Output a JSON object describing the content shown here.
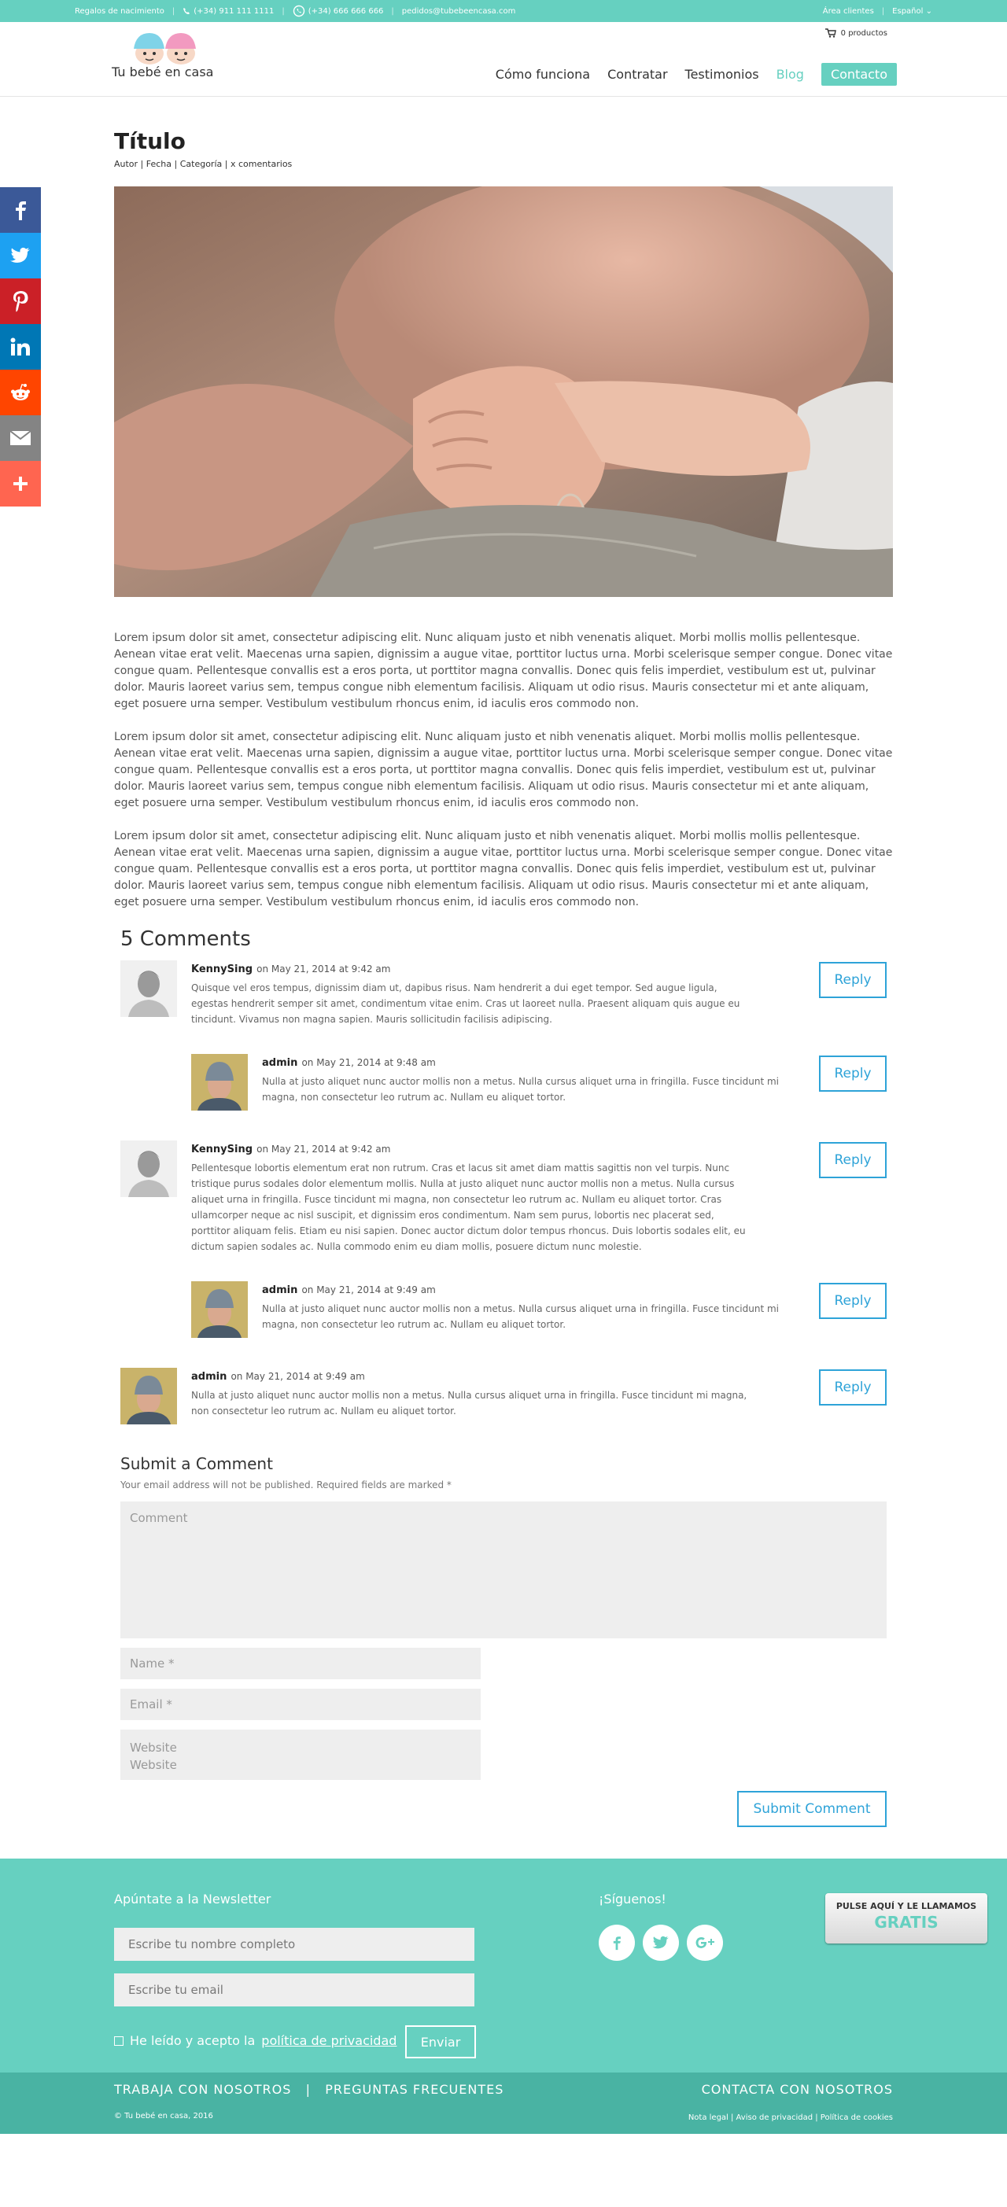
{
  "topbar": {
    "gifts": "Regalos de nacimiento",
    "phone": "(+34) 911 111 1111",
    "whatsapp": "(+34) 666 666 666",
    "email": "pedidos@tubebeencasa.com",
    "client_area": "Área clientes",
    "language": "Español"
  },
  "header": {
    "logo_text": "Tu bebé en casa",
    "cart": "0 productos",
    "nav": [
      "Cómo funciona",
      "Contratar",
      "Testimonios",
      "Blog",
      "Contacto"
    ]
  },
  "post": {
    "title": "Título",
    "meta": "Autor | Fecha | Categoría | x comentarios",
    "paragraphs": [
      "Lorem ipsum dolor sit amet, consectetur adipiscing elit. Nunc aliquam justo et nibh venenatis aliquet. Morbi mollis mollis pellentesque. Aenean vitae erat velit. Maecenas urna sapien, dignissim a augue vitae, porttitor luctus urna. Morbi scelerisque semper congue. Donec vitae congue quam. Pellentesque convallis est a eros porta, ut porttitor magna convallis. Donec quis felis imperdiet, vestibulum est ut, pulvinar dolor. Mauris laoreet varius sem, tempus congue nibh elementum facilisis. Aliquam ut odio risus. Mauris consectetur mi et ante aliquam, eget posuere urna semper. Vestibulum vestibulum rhoncus enim, id iaculis eros commodo non.",
      "Lorem ipsum dolor sit amet, consectetur adipiscing elit. Nunc aliquam justo et nibh venenatis aliquet. Morbi mollis mollis pellentesque. Aenean vitae erat velit. Maecenas urna sapien, dignissim a augue vitae, porttitor luctus urna. Morbi scelerisque semper congue. Donec vitae congue quam. Pellentesque convallis est a eros porta, ut porttitor magna convallis. Donec quis felis imperdiet, vestibulum est ut, pulvinar dolor. Mauris laoreet varius sem, tempus congue nibh elementum facilisis. Aliquam ut odio risus. Mauris consectetur mi et ante aliquam, eget posuere urna semper. Vestibulum vestibulum rhoncus enim, id iaculis eros commodo non.",
      "Lorem ipsum dolor sit amet, consectetur adipiscing elit. Nunc aliquam justo et nibh venenatis aliquet. Morbi mollis mollis pellentesque. Aenean vitae erat velit. Maecenas urna sapien, dignissim a augue vitae, porttitor luctus urna. Morbi scelerisque semper congue. Donec vitae congue quam. Pellentesque convallis est a eros porta, ut porttitor magna convallis. Donec quis felis imperdiet, vestibulum est ut, pulvinar dolor. Mauris laoreet varius sem, tempus congue nibh elementum facilisis. Aliquam ut odio risus. Mauris consectetur mi et ante aliquam, eget posuere urna semper. Vestibulum vestibulum rhoncus enim, id iaculis eros commodo non."
    ]
  },
  "comments": {
    "heading": "5 Comments",
    "reply_label": "Reply",
    "items": [
      {
        "author": "KennySing",
        "date": "on May 21, 2014 at 9:42 am",
        "text": "Quisque vel eros tempus, dignissim diam ut, dapibus risus. Nam hendrerit a dui eget tempor. Sed augue ligula, egestas hendrerit semper sit amet, condimentum vitae enim. Cras ut laoreet nulla. Praesent aliquam quis augue eu tincidunt. Vivamus non magna sapien. Mauris sollicitudin facilisis adipiscing."
      },
      {
        "author": "admin",
        "date": "on May 21, 2014 at 9:48 am",
        "text": "Nulla at justo aliquet nunc auctor mollis non a metus. Nulla cursus aliquet urna in fringilla. Fusce tincidunt mi magna, non consectetur leo rutrum ac. Nullam eu aliquet tortor."
      },
      {
        "author": "KennySing",
        "date": "on May 21, 2014 at 9:42 am",
        "text": "Pellentesque lobortis elementum erat non rutrum. Cras et lacus sit amet diam mattis sagittis non vel turpis. Nunc tristique purus sodales dolor elementum mollis. Nulla at justo aliquet nunc auctor mollis non a metus. Nulla cursus aliquet urna in fringilla. Fusce tincidunt mi magna, non consectetur leo rutrum ac. Nullam eu aliquet tortor. Cras ullamcorper neque ac nisl suscipit, et dignissim eros condimentum. Nam sem purus, lobortis nec placerat sed, porttitor aliquam felis. Etiam eu nisi sapien. Donec auctor dictum dolor tempus rhoncus. Duis lobortis sodales elit, eu dictum sapien sodales ac. Nulla commodo enim eu diam mollis, posuere dictum nunc molestie."
      },
      {
        "author": "admin",
        "date": "on May 21, 2014 at 9:49 am",
        "text": "Nulla at justo aliquet nunc auctor mollis non a metus. Nulla cursus aliquet urna in fringilla. Fusce tincidunt mi magna, non consectetur leo rutrum ac. Nullam eu aliquet tortor."
      },
      {
        "author": "admin",
        "date": "on May 21, 2014 at 9:49 am",
        "text": "Nulla at justo aliquet nunc auctor mollis non a metus. Nulla cursus aliquet urna in fringilla. Fusce tincidunt mi magna, non consectetur leo rutrum ac. Nullam eu aliquet tortor."
      }
    ]
  },
  "submit": {
    "heading": "Submit a Comment",
    "note": "Your email address will not be published. Required fields are marked *",
    "comment_placeholder": "Comment",
    "name_placeholder": "Name *",
    "email_placeholder": "Email *",
    "website_placeholder": "Website",
    "website_label": "Website",
    "button": "Submit Comment"
  },
  "footer": {
    "newsletter_title": "Apúntate a la Newsletter",
    "name_placeholder": "Escribe tu nombre completo",
    "email_placeholder": "Escribe tu email",
    "accept_text": "He leído y acepto la",
    "privacy_link": "política de privacidad",
    "send": "Enviar",
    "follow": "¡Síguenos!",
    "call_line1": "PULSE AQUÍ Y LE LLAMAMOS",
    "call_line2": "GRATIS",
    "links": "TRABAJA CON NOSOTROS   |   PREGUNTAS FRECUENTES",
    "copyright": "© Tu bebé en casa, 2016",
    "contact": "CONTACTA CON NOSOTROS",
    "legal": "Nota legal | Aviso de privacidad | Política de cookies"
  },
  "colors": {
    "accent": "#66d0c0",
    "accent_dark": "#49b3a3",
    "link_blue": "#2ea3d8",
    "facebook": "#3b5998",
    "twitter": "#1da1f2",
    "pinterest": "#cb2027",
    "linkedin": "#0077b5",
    "reddit": "#ff4500",
    "email": "#848484",
    "more": "#ff6550"
  },
  "icons": {
    "share": [
      "facebook-icon",
      "twitter-icon",
      "pinterest-icon",
      "linkedin-icon",
      "reddit-icon",
      "email-icon",
      "plus-icon"
    ],
    "follow": [
      "facebook-icon",
      "twitter-icon",
      "google-plus-icon"
    ]
  }
}
